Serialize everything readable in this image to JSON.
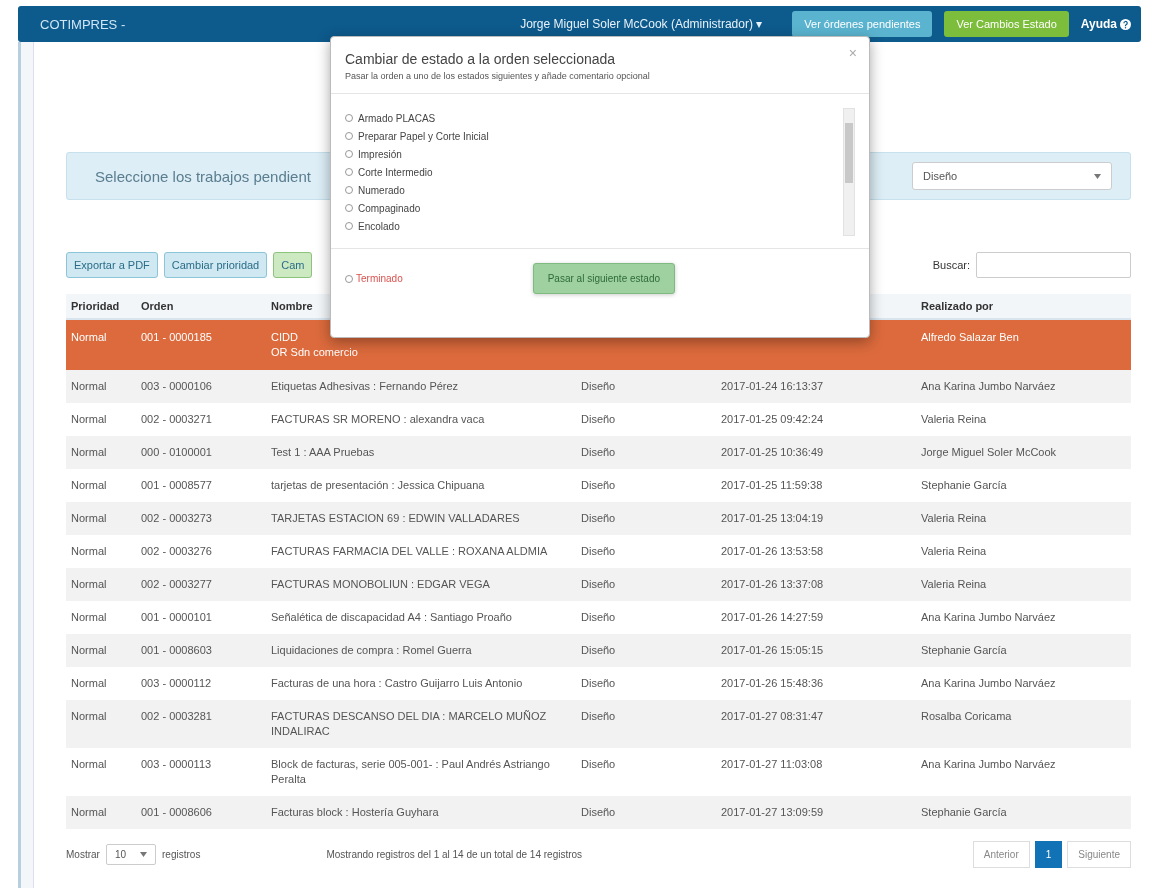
{
  "navbar": {
    "brand": "COTIMPRES -",
    "user": "Jorge Miguel Soler McCook (Administrador) ▾",
    "buttons": [
      {
        "label": "Ver órdenes pendientes",
        "kind": "info"
      },
      {
        "label": "Ver Cambios Estado",
        "kind": "success"
      }
    ],
    "help": "Ayuda"
  },
  "banner": {
    "text": "Seleccione los trabajos pendient",
    "select": "Diseño"
  },
  "toolbar": {
    "buttons": [
      {
        "label": "Exportar a PDF",
        "kind": "info"
      },
      {
        "label": "Cambiar prioridad",
        "kind": "info"
      },
      {
        "label": "Cam",
        "kind": "success"
      }
    ],
    "search_label": "Buscar:"
  },
  "table": {
    "columns": [
      "Prioridad",
      "Orden",
      "Nombre",
      "",
      "",
      "Realizado por"
    ],
    "rows": [
      {
        "selected": true,
        "cells": [
          "Normal",
          "001 - 0000185",
          "CIDD\nOR Sdn comercio",
          "",
          "",
          "Alfredo Salazar Ben"
        ]
      },
      {
        "selected": false,
        "cells": [
          "Normal",
          "003 - 0000106",
          "Etiquetas Adhesivas : Fernando Pérez",
          "Diseño",
          "2017-01-24 16:13:37",
          "Ana Karina Jumbo Narváez"
        ]
      },
      {
        "selected": false,
        "cells": [
          "Normal",
          "002 - 0003271",
          "FACTURAS SR MORENO : alexandra vaca",
          "Diseño",
          "2017-01-25 09:42:24",
          "Valeria Reina"
        ]
      },
      {
        "selected": false,
        "cells": [
          "Normal",
          "000 - 0100001",
          "Test 1 : AAA Pruebas",
          "Diseño",
          "2017-01-25 10:36:49",
          "Jorge Miguel Soler McCook"
        ]
      },
      {
        "selected": false,
        "cells": [
          "Normal",
          "001 - 0008577",
          "tarjetas de presentación : Jessica Chipuana",
          "Diseño",
          "2017-01-25 11:59:38",
          "Stephanie García"
        ]
      },
      {
        "selected": false,
        "cells": [
          "Normal",
          "002 - 0003273",
          "TARJETAS ESTACION 69 : EDWIN VALLADARES",
          "Diseño",
          "2017-01-25 13:04:19",
          "Valeria Reina"
        ]
      },
      {
        "selected": false,
        "cells": [
          "Normal",
          "002 - 0003276",
          "FACTURAS FARMACIA DEL VALLE : ROXANA ALDMIA",
          "Diseño",
          "2017-01-26 13:53:58",
          "Valeria Reina"
        ]
      },
      {
        "selected": false,
        "cells": [
          "Normal",
          "002 - 0003277",
          "FACTURAS MONOBOLIUN : EDGAR VEGA",
          "Diseño",
          "2017-01-26 13:37:08",
          "Valeria Reina"
        ]
      },
      {
        "selected": false,
        "cells": [
          "Normal",
          "001 - 0000101",
          "Señalética de discapacidad A4 : Santiago Proaño",
          "Diseño",
          "2017-01-26 14:27:59",
          "Ana Karina Jumbo Narváez"
        ]
      },
      {
        "selected": false,
        "cells": [
          "Normal",
          "001 - 0008603",
          "Liquidaciones de compra : Romel Guerra",
          "Diseño",
          "2017-01-26 15:05:15",
          "Stephanie García"
        ]
      },
      {
        "selected": false,
        "cells": [
          "Normal",
          "003 - 0000112",
          "Facturas de una hora : Castro Guijarro Luis Antonio",
          "Diseño",
          "2017-01-26 15:48:36",
          "Ana Karina Jumbo Narváez"
        ]
      },
      {
        "selected": false,
        "cells": [
          "Normal",
          "002 - 0003281",
          "FACTURAS DESCANSO DEL DIA : MARCELO MUÑOZ INDALIRAC",
          "Diseño",
          "2017-01-27 08:31:47",
          "Rosalba Coricama"
        ]
      },
      {
        "selected": false,
        "cells": [
          "Normal",
          "003 - 0000113",
          "Block de facturas, serie 005-001- : Paul Andrés Astriango Peralta",
          "Diseño",
          "2017-01-27 11:03:08",
          "Ana Karina Jumbo Narváez"
        ]
      },
      {
        "selected": false,
        "cells": [
          "Normal",
          "001 - 0008606",
          "Facturas block : Hostería Guyhara",
          "Diseño",
          "2017-01-27 13:09:59",
          "Stephanie García"
        ]
      }
    ]
  },
  "footer": {
    "show_label": "Mostrar",
    "page_size": "10",
    "records_label": "registros",
    "info": "Mostrando registros del 1 al 14 de un total de 14 registros",
    "pages": [
      {
        "label": "Anterior",
        "selected": false
      },
      {
        "label": "1",
        "selected": true
      },
      {
        "label": "Siguiente",
        "selected": false
      }
    ]
  },
  "modal": {
    "title": "Cambiar de estado a la orden seleccionada",
    "subtitle": "Pasar la orden a uno de los estados siguientes y añade comentario opcional",
    "close": "×",
    "options": [
      {
        "label": "Armado PLACAS",
        "selected": false
      },
      {
        "label": "Preparar Papel y Corte Inicial",
        "selected": false
      },
      {
        "label": "Impresión",
        "selected": false
      },
      {
        "label": "Corte Intermedio",
        "selected": false
      },
      {
        "label": "Numerado",
        "selected": false
      },
      {
        "label": "Compaginado",
        "selected": false
      },
      {
        "label": "Encolado",
        "selected": false
      }
    ],
    "finish": {
      "label": "Terminado",
      "selected": false
    },
    "submit": "Pasar al siguiente estado"
  }
}
